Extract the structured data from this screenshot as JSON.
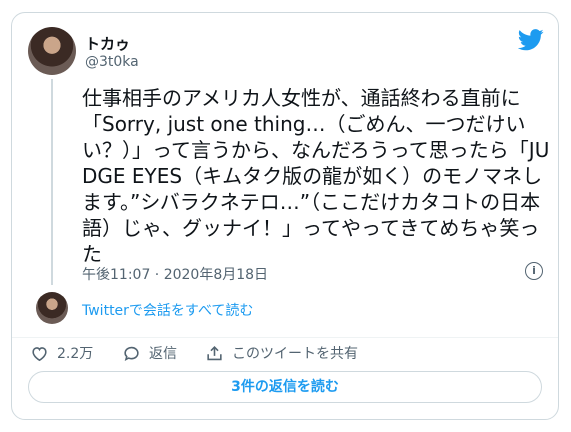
{
  "author": {
    "display_name": "トカゥ",
    "handle": "@3t0ka"
  },
  "tweet": {
    "text": "仕事相手のアメリカ人女性が、通話終わる直前に「Sorry, just one thing…（ごめん、一つだけいい？）」って言うから、なんだろうって思ったら「JUDGE EYES（キムタク版の龍が如く）のモノマネします。”シバラクネテロ…”（ここだけカタコトの日本語）じゃ、グッナイ！」ってやってきてめちゃ笑った",
    "timestamp": "午後11:07 · 2020年8月18日"
  },
  "thread": {
    "read_conversation_label": "Twitterで会話をすべて読む"
  },
  "actions": {
    "like_count": "2.2万",
    "reply_label": "返信",
    "share_label": "このツイートを共有"
  },
  "footer": {
    "read_replies_label": "3件の返信を読む"
  },
  "icons": {
    "brand": "twitter-bird-icon",
    "info": "info-icon",
    "like": "heart-icon",
    "reply": "speech-bubble-icon",
    "share": "upload-icon"
  },
  "colors": {
    "accent": "#1d9bf0",
    "text_primary": "#0f1419",
    "text_secondary": "#536471",
    "border": "#cfd9de"
  }
}
